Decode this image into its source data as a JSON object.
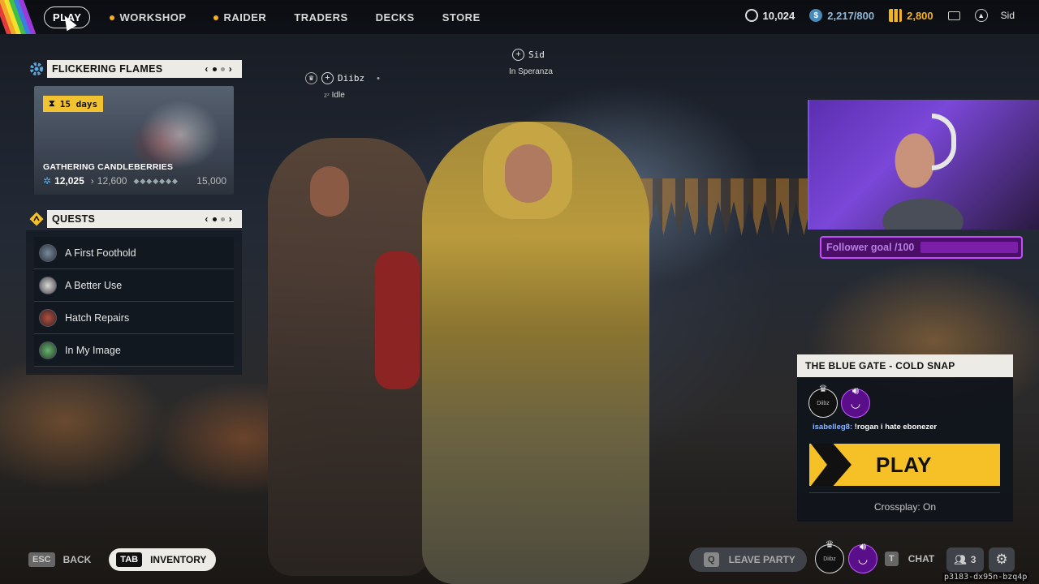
{
  "nav": {
    "items": [
      {
        "label": "PLAY",
        "active": true
      },
      {
        "label": "WORKSHOP",
        "dot": true
      },
      {
        "label": "RAIDER",
        "dot": true
      },
      {
        "label": "TRADERS"
      },
      {
        "label": "DECKS"
      },
      {
        "label": "STORE"
      }
    ]
  },
  "currencies": {
    "coins": "10,024",
    "credits": "2,217/800",
    "bars": "2,800",
    "username": "Sid"
  },
  "event": {
    "title": "FLICKERING FLAMES",
    "days_left": "15 days",
    "name": "GATHERING CANDLEBERRIES",
    "current": "12,025",
    "next": "12,600",
    "max": "15,000"
  },
  "quests": {
    "title": "QUESTS",
    "items": [
      {
        "label": "A First Foothold"
      },
      {
        "label": "A Better Use"
      },
      {
        "label": "Hatch Repairs"
      },
      {
        "label": "In My Image"
      }
    ]
  },
  "party": {
    "member1": {
      "name": "Diibz",
      "status": "Idle"
    },
    "member2": {
      "name": "Sid",
      "status": "In Speranza"
    }
  },
  "overlay": {
    "follower_goal": "Follower goal /100"
  },
  "lobby": {
    "map": "THE BLUE GATE - COLD SNAP",
    "chat_user": "isabelleg8:",
    "chat_text": "!rogan i hate ebonezer",
    "play_label": "PLAY",
    "crossplay": "Crossplay: On"
  },
  "bottom": {
    "back_key": "ESC",
    "back_label": "BACK",
    "inv_key": "TAB",
    "inv_label": "INVENTORY",
    "leave_key": "Q",
    "leave_label": "LEAVE PARTY",
    "chat_key": "T",
    "chat_label": "CHAT",
    "party_count": "3",
    "build_id": "p3183-dx95n-bzq4p"
  },
  "colors": {
    "accent_yellow": "#f5c126",
    "twitch_purple": "#c64bff"
  }
}
